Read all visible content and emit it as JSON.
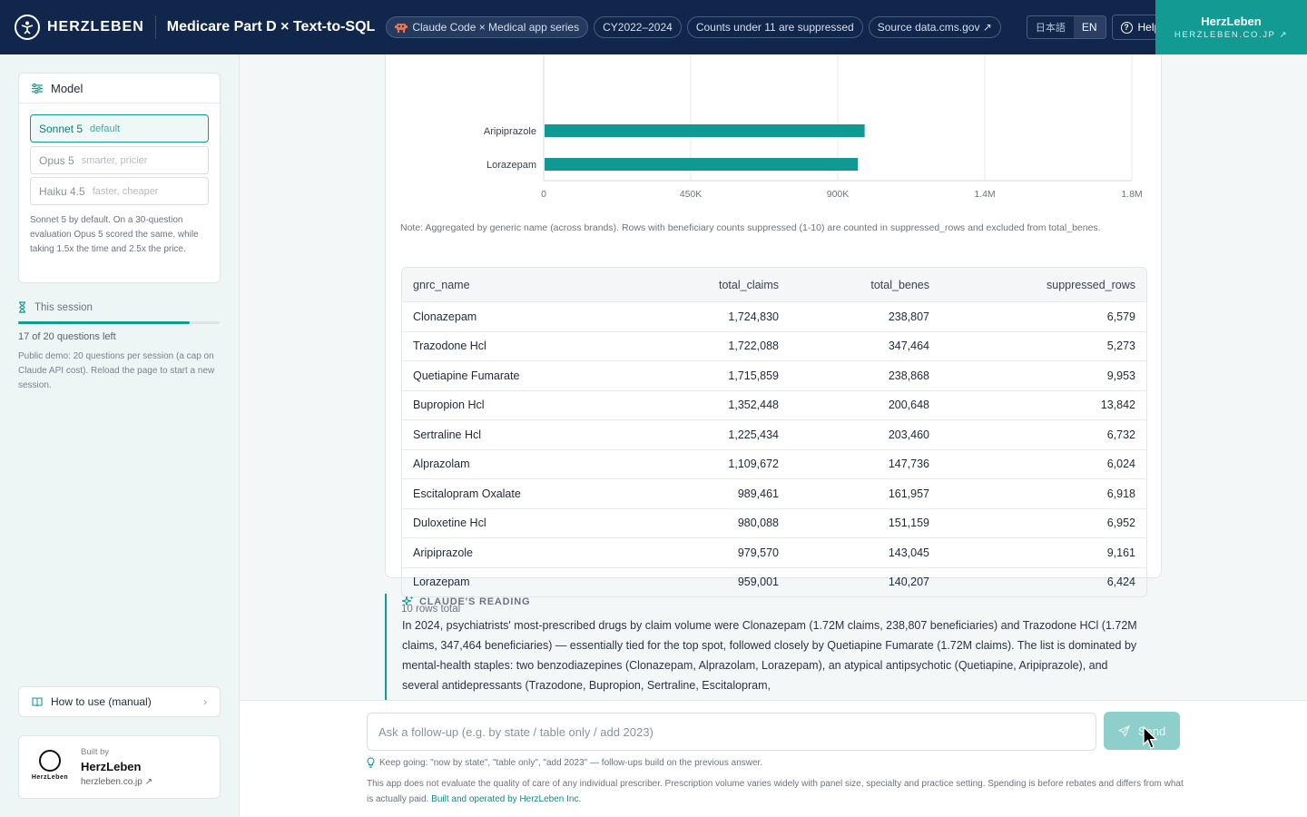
{
  "header": {
    "logo_text": "HERZLEBEN",
    "app_title": "Medicare Part D × Text-to-SQL",
    "pills": [
      "Claude Code × Medical app series",
      "CY2022–2024",
      "Counts under 11 are suppressed",
      "Source data.cms.gov ↗"
    ],
    "lang_ja": "日本語",
    "lang_en": "EN",
    "help_label": "Help",
    "brand_name": "HerzLeben",
    "brand_url": "HERZLEBEN.CO.JP ↗"
  },
  "sidebar": {
    "model_title": "Model",
    "models": [
      {
        "name": "Sonnet 5",
        "sub": "default",
        "selected": true
      },
      {
        "name": "Opus 5",
        "sub": "smarter, pricier",
        "selected": false
      },
      {
        "name": "Haiku 4.5",
        "sub": "faster, cheaper",
        "selected": false
      }
    ],
    "model_note": "Sonnet 5 by default. On a 30-question evaluation Opus 5 scored the same, while taking 1.5x the time and 2.5x the price.",
    "session_label": "This session",
    "questions_left_text": "17 of 20 questions left",
    "questions_progress": 0.85,
    "session_note": "Public demo: 20 questions per session (a cap on Claude API cost). Reload the page to start a new session.",
    "manual_label": "How to use (manual)",
    "built_by_label": "Built by",
    "built_by_name": "HerzLeben",
    "built_by_url": "herzleben.co.jp ↗",
    "built_logo_text": "HerzLeben"
  },
  "chart_data": {
    "type": "bar",
    "orientation": "horizontal",
    "categories": [
      "Aripiprazole",
      "Lorazepam"
    ],
    "values": [
      979570,
      959001
    ],
    "xlim": [
      0,
      1800000
    ],
    "x_ticks": [
      {
        "value": 0,
        "label": "0"
      },
      {
        "value": 450000,
        "label": "450K"
      },
      {
        "value": 900000,
        "label": "900K"
      },
      {
        "value": 1350000,
        "label": "1.4M"
      },
      {
        "value": 1800000,
        "label": "1.8M"
      }
    ],
    "bar_color": "#0e9a93",
    "grid": true
  },
  "result": {
    "note": "Note: Aggregated by generic name (across brands). Rows with beneficiary counts suppressed (1-10) are counted in suppressed_rows and excluded from total_benes.",
    "columns": [
      "gnrc_name",
      "total_claims",
      "total_benes",
      "suppressed_rows"
    ],
    "rows": [
      [
        "Clonazepam",
        "1,724,830",
        "238,807",
        "6,579"
      ],
      [
        "Trazodone Hcl",
        "1,722,088",
        "347,464",
        "5,273"
      ],
      [
        "Quetiapine Fumarate",
        "1,715,859",
        "238,868",
        "9,953"
      ],
      [
        "Bupropion Hcl",
        "1,352,448",
        "200,648",
        "13,842"
      ],
      [
        "Sertraline Hcl",
        "1,225,434",
        "203,460",
        "6,732"
      ],
      [
        "Alprazolam",
        "1,109,672",
        "147,736",
        "6,024"
      ],
      [
        "Escitalopram Oxalate",
        "989,461",
        "161,957",
        "6,918"
      ],
      [
        "Duloxetine Hcl",
        "980,088",
        "151,159",
        "6,952"
      ],
      [
        "Aripiprazole",
        "979,570",
        "143,045",
        "9,161"
      ],
      [
        "Lorazepam",
        "959,001",
        "140,207",
        "6,424"
      ]
    ],
    "rows_total": "10 rows total"
  },
  "reading": {
    "title": "CLAUDE'S READING",
    "text": "In 2024, psychiatrists' most-prescribed drugs by claim volume were Clonazepam (1.72M claims, 238,807 beneficiaries) and Trazodone HCl (1.72M claims, 347,464 beneficiaries) — essentially tied for the top spot, followed closely by Quetiapine Fumarate (1.72M claims). The list is dominated by mental-health staples: two benzodiazepines (Clonazepam, Alprazolam, Lorazepam), an atypical antipsychotic (Quetiapine, Aripiprazole), and several antidepressants (Trazodone, Bupropion, Sertraline, Escitalopram,"
  },
  "composer": {
    "placeholder": "Ask a follow-up (e.g. by state / table only / add 2023)",
    "send_label": "Send",
    "tip": "Keep going: \"now by state\", \"table only\", \"add 2023\" — follow-ups build on the previous answer.",
    "disclaimer": "This app does not evaluate the quality of care of any individual prescriber. Prescription volume varies widely with panel size, specialty and practice setting. Spending is before rebates and differs from what is actually paid.",
    "disclaimer_link": "Built and operated by HerzLeben Inc."
  },
  "colors": {
    "navy": "#10264a",
    "teal": "#129b93",
    "bar": "#0e9a93"
  },
  "icons": {
    "logo": "herzleben-figure-icon",
    "series_badge": "robot-icon",
    "help": "question-circle-icon",
    "model": "sliders-icon",
    "session": "hourglass-icon",
    "manual": "book-icon",
    "manual_chevron": "chevron-right-icon",
    "reading": "sparkle-icon",
    "send": "paper-plane-icon",
    "tip": "lightbulb-icon"
  }
}
